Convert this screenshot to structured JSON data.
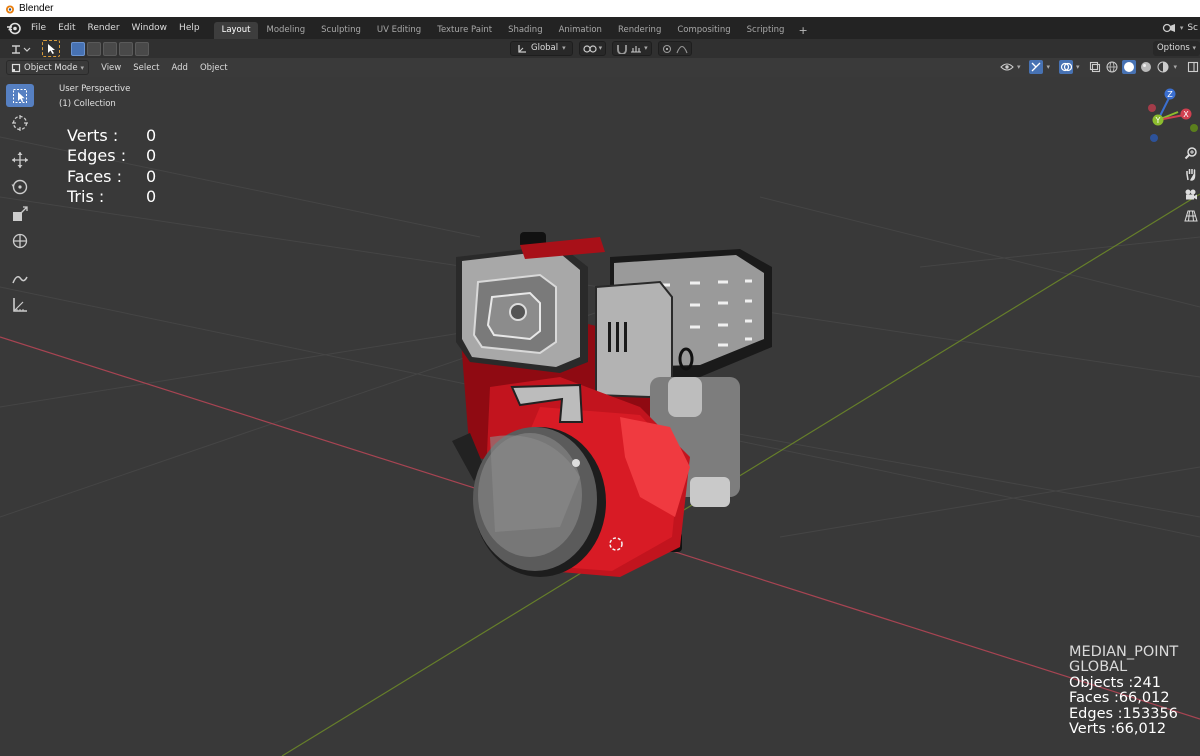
{
  "window": {
    "title": "Blender"
  },
  "menu": [
    "File",
    "Edit",
    "Render",
    "Window",
    "Help"
  ],
  "workspaces": [
    {
      "label": "Layout",
      "active": true
    },
    {
      "label": "Modeling",
      "active": false
    },
    {
      "label": "Sculpting",
      "active": false
    },
    {
      "label": "UV Editing",
      "active": false
    },
    {
      "label": "Texture Paint",
      "active": false
    },
    {
      "label": "Shading",
      "active": false
    },
    {
      "label": "Animation",
      "active": false
    },
    {
      "label": "Rendering",
      "active": false
    },
    {
      "label": "Compositing",
      "active": false
    },
    {
      "label": "Scripting",
      "active": false
    }
  ],
  "workspace_add": "+",
  "topbar_right_scene_fragment": "Sc",
  "tool_header": {
    "transform_orientation": "Global",
    "options_label": "Options"
  },
  "viewport_header": {
    "mode": "Object Mode",
    "menus": [
      "View",
      "Select",
      "Add",
      "Object"
    ]
  },
  "viewport": {
    "perspective": "User Perspective",
    "collection": "(1) Collection",
    "stats": [
      {
        "label": "Verts :",
        "value": "0"
      },
      {
        "label": "Edges :",
        "value": "0"
      },
      {
        "label": "Faces :",
        "value": "0"
      },
      {
        "label": "Tris :",
        "value": "0"
      }
    ],
    "info": {
      "pivot": "MEDIAN_POINT",
      "orientation": "GLOBAL",
      "objects": "Objects :241",
      "faces": "Faces :66,012",
      "edges": "Edges :153356",
      "verts": "Verts :66,012"
    },
    "gizmo_axes": [
      "Z",
      "Y",
      "X"
    ]
  },
  "colors": {
    "active_blue": "#5680c2",
    "x_axis": "#b34a54",
    "y_axis": "#6f8a2a",
    "engine_red": "#c2141e"
  }
}
